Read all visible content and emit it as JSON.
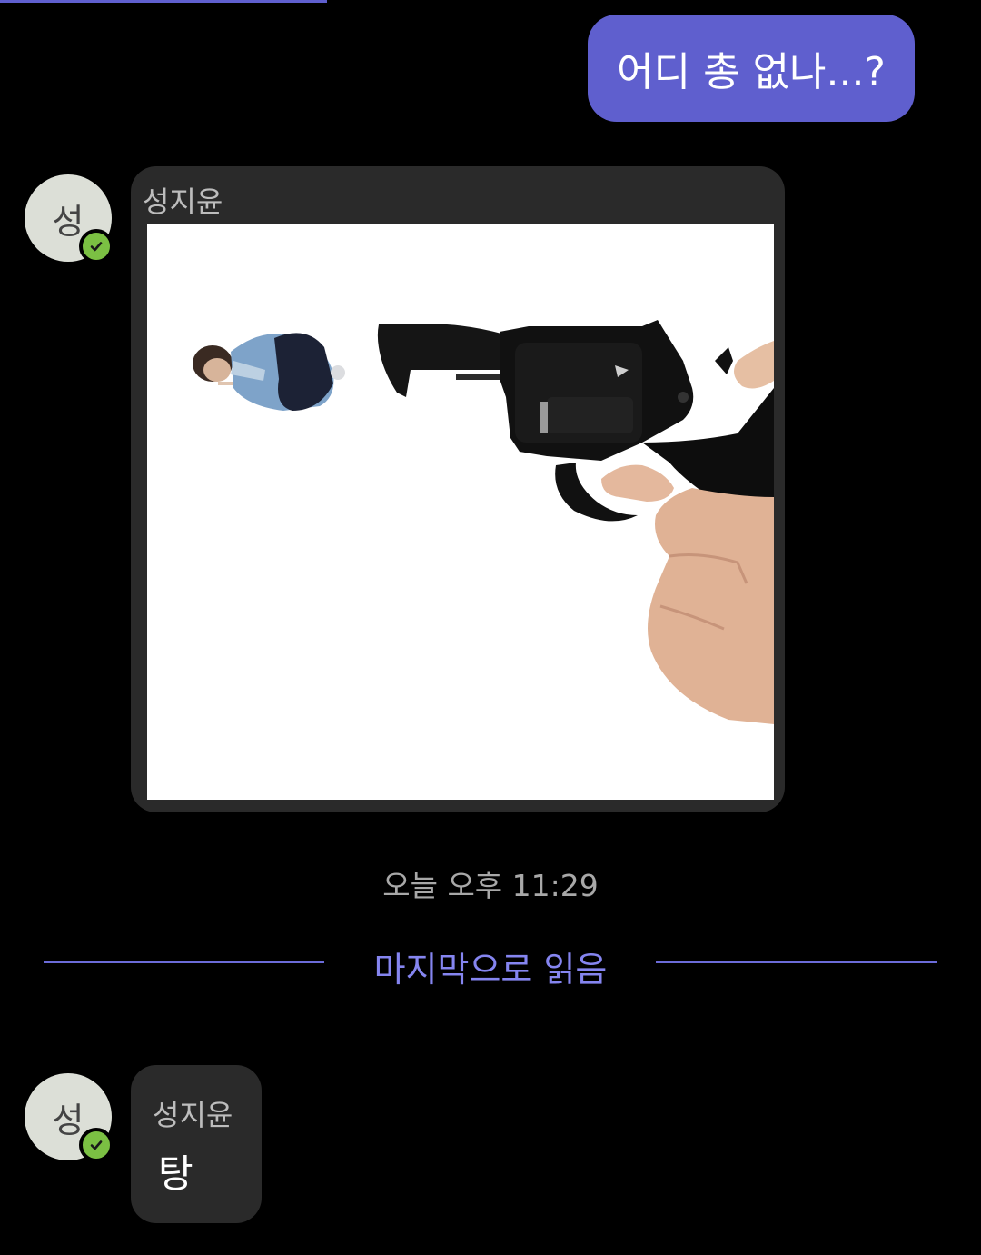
{
  "messages": [
    {
      "direction": "outgoing",
      "text": "어디 총 없나...?"
    },
    {
      "direction": "incoming",
      "sender": "성지윤",
      "avatar_initial": "성",
      "type": "image",
      "image_description": "revolver-pointing-at-cutout-person"
    },
    {
      "direction": "incoming",
      "sender": "성지윤",
      "avatar_initial": "성",
      "type": "text",
      "text": "탕"
    }
  ],
  "timestamp": "오늘 오후 11:29",
  "read_marker": "마지막으로 읽음",
  "colors": {
    "outgoing_bubble": "#5f5fce",
    "incoming_bubble": "#2a2a2a",
    "read_marker": "#8585f0",
    "verified_badge": "#7bc043"
  },
  "icons": {
    "verified": "check-circle-icon"
  }
}
